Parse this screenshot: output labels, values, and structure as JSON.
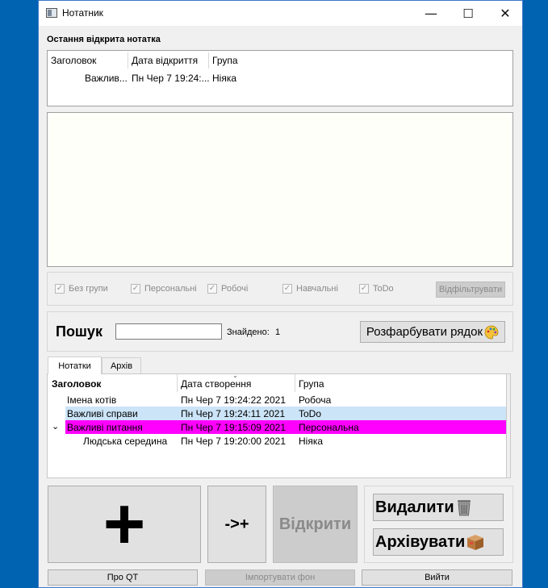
{
  "window": {
    "title": "Нотатник",
    "controls": {
      "minimize": "—",
      "maximize": "☐",
      "close": "✕"
    }
  },
  "last_opened": {
    "label": "Остання відкрита нотатка",
    "columns": [
      "Заголовок",
      "Дата відкриття",
      "Група"
    ],
    "row": [
      "Важлив...",
      "Пн Чер 7 19:24:...",
      "Ніяка"
    ]
  },
  "filters": {
    "items": [
      "Без групи",
      "Персональні",
      "Робочі",
      "Навчальні",
      "ToDo"
    ],
    "button": "Відфільтрувати"
  },
  "search": {
    "label": "Пошук",
    "value": "",
    "found_label": "Знайдено:",
    "found_count": "1",
    "colorize_button": "Розфарбувати рядок",
    "colorize_icon": "palette-icon"
  },
  "tabs": [
    "Нотатки",
    "Архів"
  ],
  "notes_table": {
    "columns": [
      "Заголовок",
      "Дата створення",
      "Група"
    ],
    "rows": [
      {
        "title": "Імена котів",
        "date": "Пн Чер 7 19:24:22 2021",
        "group": "Робоча",
        "bg": "#ffffff",
        "indent": 0
      },
      {
        "title": "Важливі справи",
        "date": "Пн Чер 7 19:24:11 2021",
        "group": "ToDo",
        "bg": "#cce4f7",
        "indent": 0
      },
      {
        "title": "Важливі питання",
        "date": "Пн Чер 7 19:15:09 2021",
        "group": "Персональна",
        "bg": "#ff00ff",
        "indent": 0
      },
      {
        "title": "Людська середина",
        "date": "Пн Чер 7 19:20:00 2021",
        "group": "Ніяка",
        "bg": "#ffffff",
        "indent": 1
      }
    ]
  },
  "actions": {
    "add": "+",
    "add_sub": "->+",
    "open": "Відкрити",
    "delete": "Видалити",
    "archive": "Архівувати"
  },
  "footer": {
    "about": "Про QT",
    "import_bg": "Імпортувати фон",
    "exit": "Вийти"
  }
}
